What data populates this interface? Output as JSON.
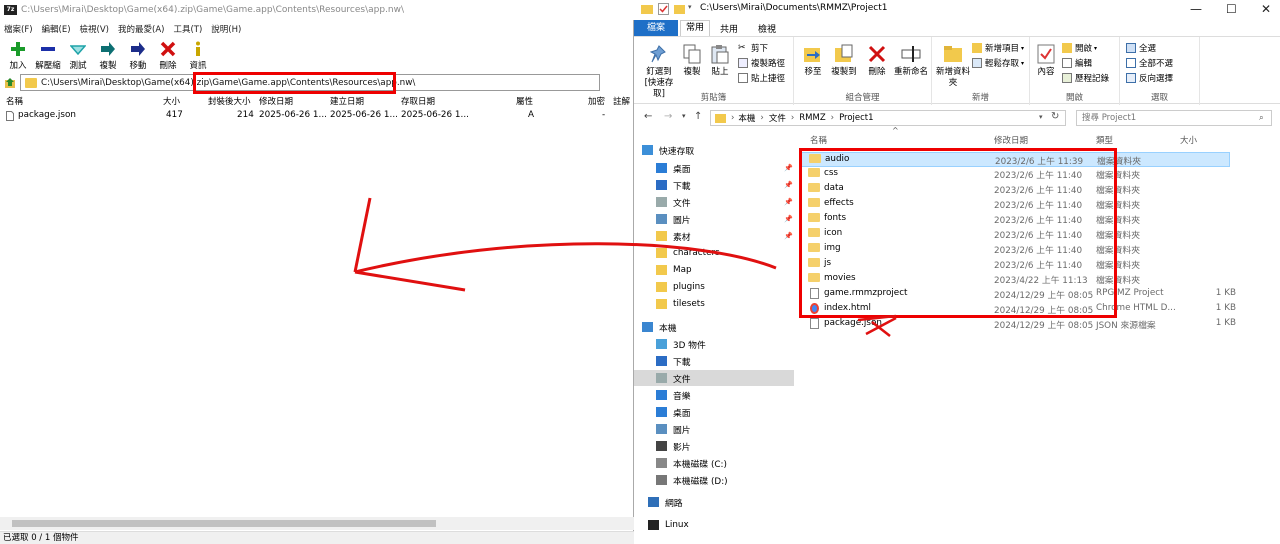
{
  "zip": {
    "title": "C:\\Users\\Mirai\\Desktop\\Game(x64).zip\\Game\\Game.app\\Contents\\Resources\\app.nw\\",
    "app_icon": "7z",
    "menu": [
      "檔案(F)",
      "編輯(E)",
      "檢視(V)",
      "我的最愛(A)",
      "工具(T)",
      "說明(H)"
    ],
    "toolbar": [
      {
        "label": "加入",
        "icon": "plus-icon",
        "color": "#1a9b2a"
      },
      {
        "label": "解壓縮",
        "icon": "minus-icon",
        "color": "#1c2fa8"
      },
      {
        "label": "測試",
        "icon": "check-icon",
        "color": "#1fa3a8"
      },
      {
        "label": "複製",
        "icon": "copy-arrow-icon",
        "color": "#0d6f72"
      },
      {
        "label": "移動",
        "icon": "move-arrow-icon",
        "color": "#1c2d8a"
      },
      {
        "label": "刪除",
        "icon": "delete-x-icon",
        "color": "#d01010"
      },
      {
        "label": "資訊",
        "icon": "info-icon",
        "color": "#c8a600"
      }
    ],
    "address": "C:\\Users\\Mirai\\Desktop\\Game(x64).zip\\Game\\Game.app\\Contents\\Resources\\app.nw\\",
    "columns": {
      "name": "名稱",
      "size": "大小",
      "packed": "封裝後大小",
      "modified": "修改日期",
      "created": "建立日期",
      "accessed": "存取日期",
      "attr": "屬性",
      "encrypted": "加密",
      "comment": "註解"
    },
    "rows": [
      {
        "name": "package.json",
        "size": "417",
        "packed": "214",
        "modified": "2025-06-26 1...",
        "created": "2025-06-26 1...",
        "accessed": "2025-06-26 1...",
        "attr": "A",
        "encrypted": "-"
      }
    ],
    "status": "已選取 0 / 1 個物件"
  },
  "explorer": {
    "title": "C:\\Users\\Mirai\\Documents\\RMMZ\\Project1",
    "tabs": {
      "file": "檔案",
      "home": "常用",
      "share": "共用",
      "view": "檢視"
    },
    "ribbon": {
      "clipboard": {
        "label": "剪貼簿",
        "pin": "釘選到 [快速存取]",
        "copy": "複製",
        "paste": "貼上",
        "cut": "剪下",
        "copy_path": "複製路徑",
        "paste_shortcut": "貼上捷徑"
      },
      "organize": {
        "label": "組合管理",
        "move_to": "移至",
        "copy_to": "複製到",
        "delete": "刪除",
        "rename": "重新命名"
      },
      "new": {
        "label": "新增",
        "new_folder": "新增資料夾",
        "new_item": "新增項目",
        "easy_access": "輕鬆存取"
      },
      "open": {
        "label": "開啟",
        "properties": "內容",
        "open": "開啟",
        "edit": "編輯",
        "history": "歷程記錄"
      },
      "select": {
        "label": "選取",
        "select_all": "全選",
        "select_none": "全部不選",
        "invert": "反向選擇"
      }
    },
    "path": [
      "本機",
      "文件",
      "RMMZ",
      "Project1"
    ],
    "search_placeholder": "搜尋 Project1",
    "nav": [
      {
        "label": "快速存取",
        "icon": "star-icon"
      },
      {
        "label": "桌面",
        "icon": "desktop-icon"
      },
      {
        "label": "下載",
        "icon": "download-icon"
      },
      {
        "label": "文件",
        "icon": "document-icon"
      },
      {
        "label": "圖片",
        "icon": "pictures-icon"
      },
      {
        "label": "素材",
        "icon": "folder-icon"
      },
      {
        "label": "characters",
        "icon": "folder-icon"
      },
      {
        "label": "Map",
        "icon": "folder-icon"
      },
      {
        "label": "plugins",
        "icon": "folder-icon"
      },
      {
        "label": "tilesets",
        "icon": "folder-icon"
      },
      {
        "label": "本機",
        "icon": "computer-icon"
      },
      {
        "label": "3D 物件",
        "icon": "3d-objects-icon"
      },
      {
        "label": "下載",
        "icon": "download-icon"
      },
      {
        "label": "文件",
        "icon": "document-icon"
      },
      {
        "label": "音樂",
        "icon": "music-icon"
      },
      {
        "label": "桌面",
        "icon": "desktop-icon"
      },
      {
        "label": "圖片",
        "icon": "pictures-icon"
      },
      {
        "label": "影片",
        "icon": "videos-icon"
      },
      {
        "label": "本機磁碟 (C:)",
        "icon": "drive-c-icon"
      },
      {
        "label": "本機磁碟 (D:)",
        "icon": "drive-d-icon"
      },
      {
        "label": "網路",
        "icon": "network-icon"
      },
      {
        "label": "Linux",
        "icon": "linux-icon"
      }
    ],
    "columns": {
      "name": "名稱",
      "modified": "修改日期",
      "type": "類型",
      "size": "大小"
    },
    "files": [
      {
        "name": "audio",
        "modified": "2023/2/6 上午 11:39",
        "type": "檔案資料夾",
        "size": "",
        "kind": "folder"
      },
      {
        "name": "css",
        "modified": "2023/2/6 上午 11:40",
        "type": "檔案資料夾",
        "size": "",
        "kind": "folder"
      },
      {
        "name": "data",
        "modified": "2023/2/6 上午 11:40",
        "type": "檔案資料夾",
        "size": "",
        "kind": "folder"
      },
      {
        "name": "effects",
        "modified": "2023/2/6 上午 11:40",
        "type": "檔案資料夾",
        "size": "",
        "kind": "folder"
      },
      {
        "name": "fonts",
        "modified": "2023/2/6 上午 11:40",
        "type": "檔案資料夾",
        "size": "",
        "kind": "folder"
      },
      {
        "name": "icon",
        "modified": "2023/2/6 上午 11:40",
        "type": "檔案資料夾",
        "size": "",
        "kind": "folder"
      },
      {
        "name": "img",
        "modified": "2023/2/6 上午 11:40",
        "type": "檔案資料夾",
        "size": "",
        "kind": "folder"
      },
      {
        "name": "js",
        "modified": "2023/2/6 上午 11:40",
        "type": "檔案資料夾",
        "size": "",
        "kind": "folder"
      },
      {
        "name": "movies",
        "modified": "2023/4/22 上午 11:13",
        "type": "檔案資料夾",
        "size": "",
        "kind": "folder"
      },
      {
        "name": "game.rmmzproject",
        "modified": "2024/12/29 上午 08:05",
        "type": "RPG MZ Project",
        "size": "1 KB",
        "kind": "file"
      },
      {
        "name": "index.html",
        "modified": "2024/12/29 上午 08:05",
        "type": "Chrome HTML D...",
        "size": "1 KB",
        "kind": "html"
      },
      {
        "name": "package.json",
        "modified": "2024/12/29 上午 08:05",
        "type": "JSON 來源檔案",
        "size": "1 KB",
        "kind": "file"
      }
    ]
  },
  "annotation_color": "#e01010"
}
